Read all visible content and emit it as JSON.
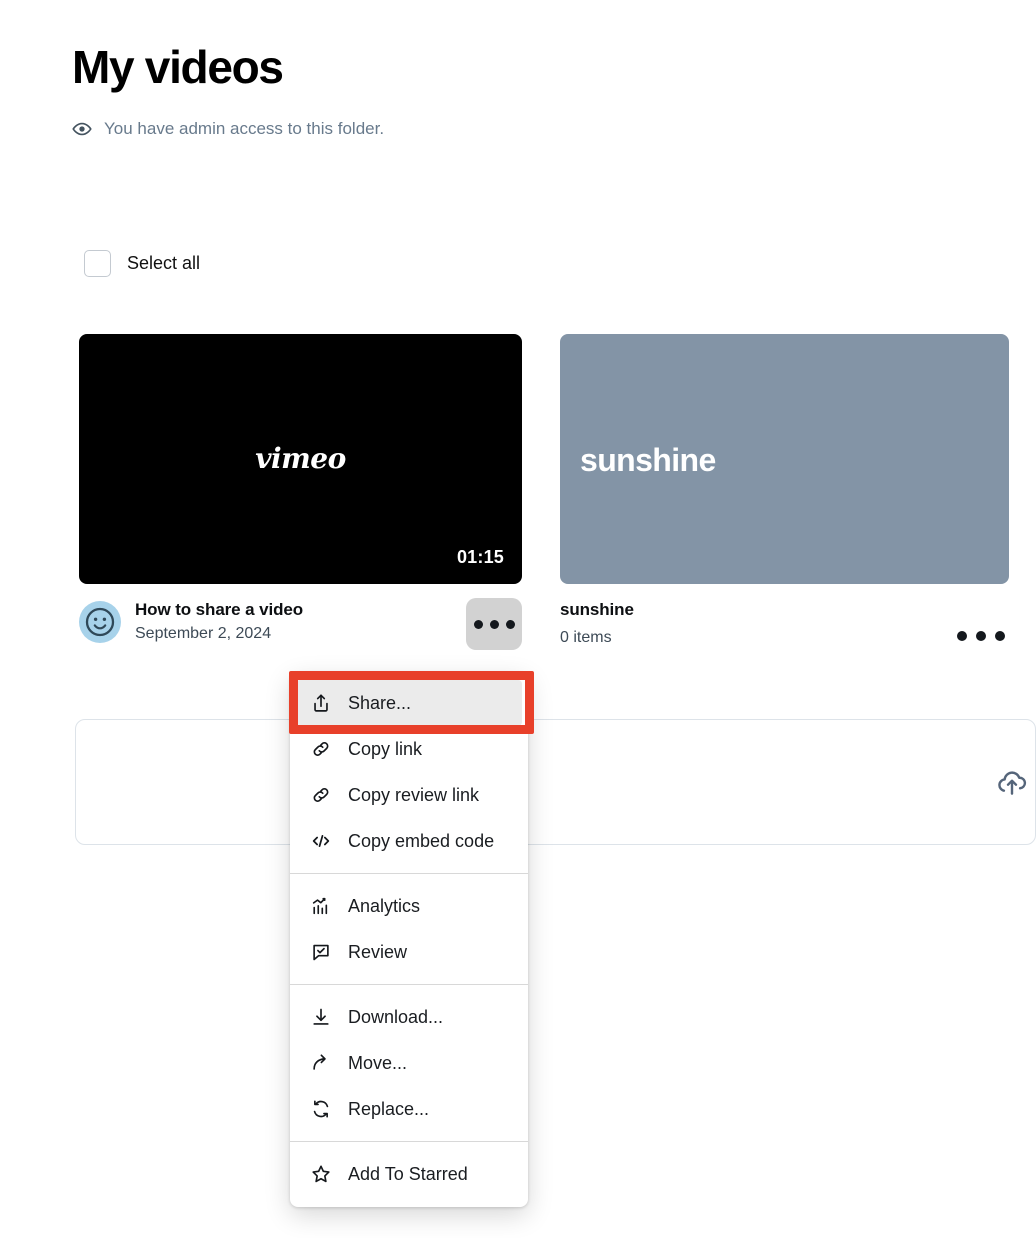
{
  "header": {
    "title": "My videos",
    "access_note": "You have admin access to this folder.",
    "eye_icon": "eye-icon"
  },
  "toolbar": {
    "select_all_label": "Select all",
    "select_all_checked": false
  },
  "grid": {
    "video": {
      "thumbnail_label": "vimeo",
      "duration": "01:15",
      "title": "How to share a video",
      "subtitle": "September 2, 2024",
      "avatar_icon": "smiley-avatar-icon",
      "more_icon": "more-options-icon",
      "thumb_bg": "#000000"
    },
    "folder": {
      "thumbnail_label": "sunshine",
      "title": "sunshine",
      "subtitle": "0 items",
      "more_icon": "more-options-icon",
      "thumb_bg": "#8394a6"
    }
  },
  "dropzone": {
    "upload_icon": "cloud-upload-icon"
  },
  "context_menu": {
    "groups": [
      {
        "items": [
          {
            "label": "Share...",
            "icon": "share-icon",
            "hovered": true
          },
          {
            "label": "Copy link",
            "icon": "link-icon",
            "hovered": false
          },
          {
            "label": "Copy review link",
            "icon": "link-icon",
            "hovered": false
          },
          {
            "label": "Copy embed code",
            "icon": "code-embed-icon",
            "hovered": false
          }
        ]
      },
      {
        "items": [
          {
            "label": "Analytics",
            "icon": "analytics-icon",
            "hovered": false
          },
          {
            "label": "Review",
            "icon": "review-icon",
            "hovered": false
          }
        ]
      },
      {
        "items": [
          {
            "label": "Download...",
            "icon": "download-icon",
            "hovered": false
          },
          {
            "label": "Move...",
            "icon": "move-arrow-icon",
            "hovered": false
          },
          {
            "label": "Replace...",
            "icon": "replace-refresh-icon",
            "hovered": false
          }
        ]
      },
      {
        "items": [
          {
            "label": "Add To Starred",
            "icon": "star-icon",
            "hovered": false
          }
        ]
      }
    ]
  },
  "annotation": {
    "target_label": "Share...",
    "color": "#e8402a"
  }
}
